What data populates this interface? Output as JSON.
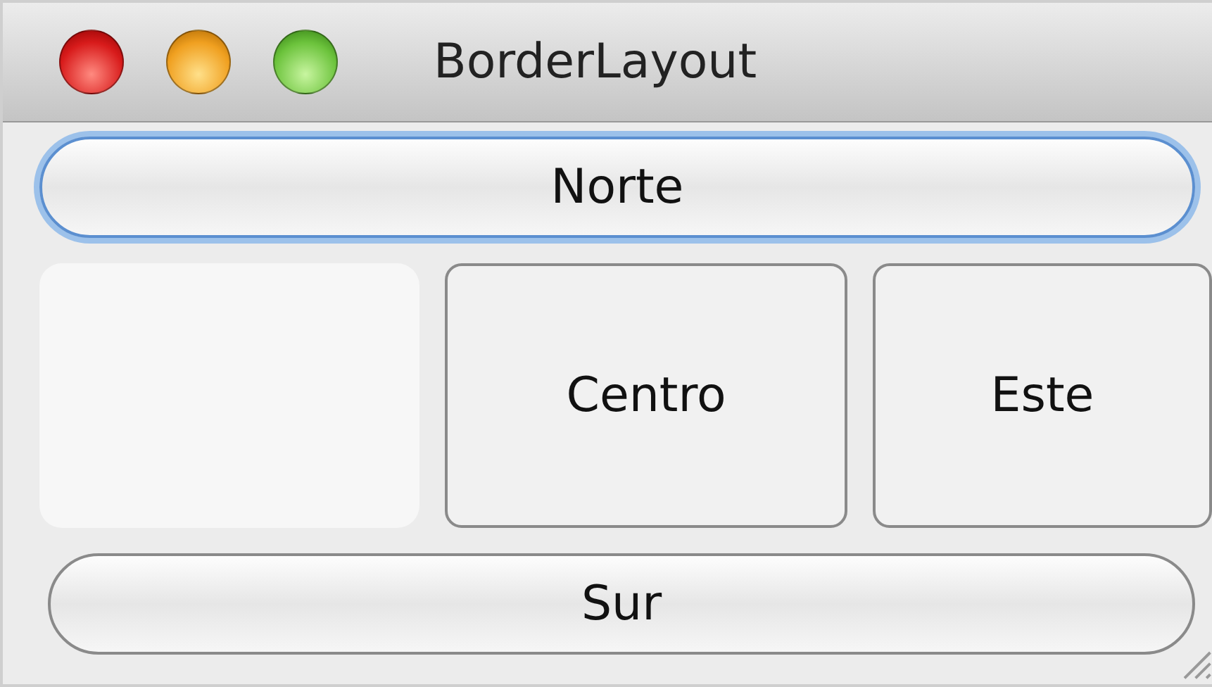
{
  "window": {
    "title": "BorderLayout"
  },
  "north": {
    "label": "Norte",
    "focused": true
  },
  "center": {
    "label": "Centro",
    "focused": false
  },
  "east": {
    "label": "Este",
    "focused": false
  },
  "south": {
    "label": "Sur",
    "focused": false
  }
}
